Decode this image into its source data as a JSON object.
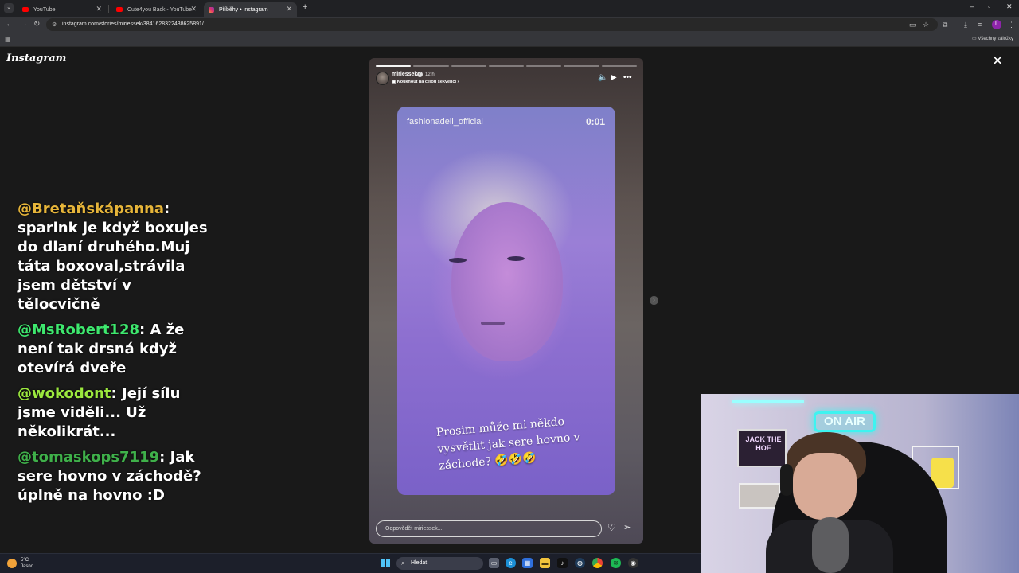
{
  "browser": {
    "tabs": [
      {
        "label": "YouTube",
        "favicon_color": "#ff0000",
        "active": false
      },
      {
        "label": "Cute4you Back - YouTube",
        "favicon_color": "#ff0000",
        "active": false
      },
      {
        "label": "Příběhy • Instagram",
        "favicon_color": "#e1306c",
        "active": true
      }
    ],
    "new_tab": "+",
    "url": "instagram.com/stories/miriessek/3841628322438625891/",
    "bookmarks_label": "Všechny záložky",
    "profile_initial": "L"
  },
  "page": {
    "logo": "Instagram",
    "close_icon": "close-icon"
  },
  "chat": [
    {
      "user": "@Bretaňskápanna",
      "user_color": "#e6b53a",
      "text": "sparink je když boxujes do dlaní druhého.Muj táta boxoval,strávila jsem dětství v tělocvičně"
    },
    {
      "user": "@MsRobert128",
      "user_color": "#3ee86e",
      "text": "A že není tak drsná když otevírá dveře"
    },
    {
      "user": "@wokodont",
      "user_color": "#9be83e",
      "text": "Její sílu jsme viděli... Už několikrát..."
    },
    {
      "user": "@tomaskops7119",
      "user_color": "#3fb04a",
      "text": "Jak sere hovno v záchodě? úplně na hovno :D"
    }
  ],
  "story": {
    "username": "miriessek",
    "time": "12 h",
    "sequence_link": "Kouknout na celou sekvenci",
    "progress_total": 7,
    "progress_done": 1,
    "inner": {
      "account": "fashionadell_official",
      "timestamp": "0:01",
      "caption": "Prosim může mi někdo vysvětlit jak sere hovno v záchode? 🤣🤣🤣"
    },
    "reply_placeholder": "Odpovědět miriessek..."
  },
  "webcam": {
    "neon_sign": "ON AIR",
    "poster_text": "JACK THE HOE"
  },
  "taskbar": {
    "weather_temp": "5°C",
    "weather_desc": "Jasno",
    "search_placeholder": "Hledat"
  }
}
